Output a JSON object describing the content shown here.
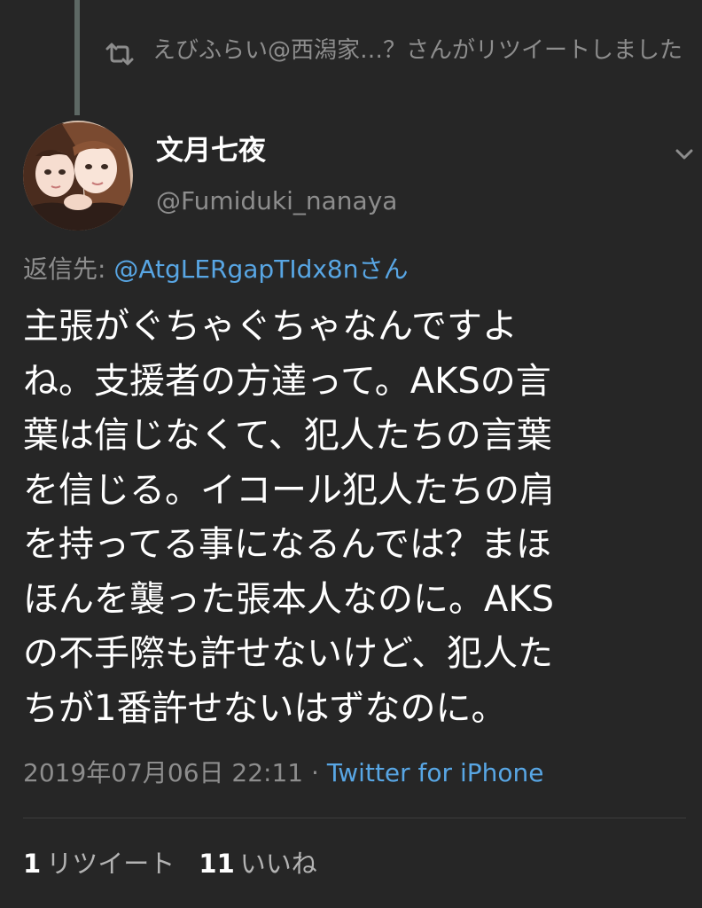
{
  "retweet_notice": {
    "text": "えびふらい@西潟家…？さんがリツイートしました",
    "icon": "retweet-icon"
  },
  "author": {
    "display_name": "文月七夜",
    "handle": "@Fumiduki_nanaya"
  },
  "reply": {
    "label": "返信先: ",
    "target": "@AtgLERgapTIdx8nさん"
  },
  "tweet": {
    "lines": [
      "主張がぐちゃぐちゃなんですよ",
      "ね。支援者の方達って。AKSの言",
      "葉は信じなくて、犯人たちの言葉",
      "を信じる。イコール犯人たちの肩",
      "を持ってる事になるんでは？まほ",
      "ほんを襲った張本人なのに。AKS",
      "の不手際も許せないけど、犯人た",
      "ちが1番許せないはずなのに。"
    ]
  },
  "meta": {
    "timestamp": "2019年07月06日 22:11",
    "separator": " · ",
    "source": "Twitter for iPhone"
  },
  "stats": {
    "retweets": {
      "count": "1",
      "label": "リツイート"
    },
    "likes": {
      "count": "11",
      "label": "いいね"
    }
  },
  "colors": {
    "background": "#262626",
    "text_primary": "#ffffff",
    "text_secondary": "#8d8d8d",
    "link": "#58a6e4",
    "thread_line": "#5d6864"
  }
}
